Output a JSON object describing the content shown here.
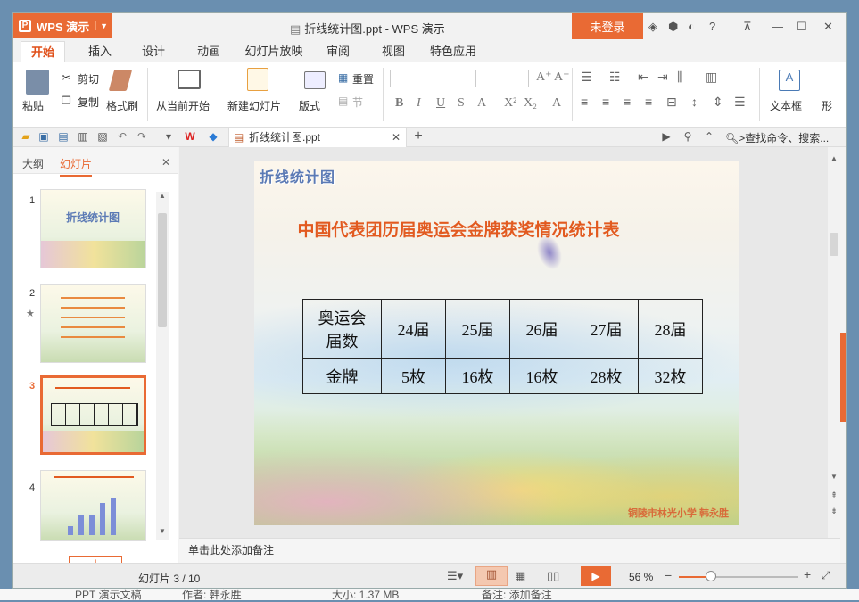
{
  "window": {
    "title": "折线统计图.ppt - WPS 演示",
    "app_button": "WPS 演示",
    "login": "未登录"
  },
  "tabs": [
    "开始",
    "插入",
    "设计",
    "动画",
    "幻灯片放映",
    "审阅",
    "视图",
    "特色应用"
  ],
  "ribbon": {
    "paste": "粘贴",
    "cut": "剪切",
    "copy": "复制",
    "format_painter": "格式刷",
    "from_current": "从当前开始",
    "new_slide": "新建幻灯片",
    "layout": "版式",
    "reset": "重置",
    "section": "节",
    "textbox": "文本框",
    "shape": "形"
  },
  "qat": {
    "doc_tab": "折线统计图.ppt",
    "search": ">查找命令、搜索..."
  },
  "left_panel": {
    "tab_outline": "大纲",
    "tab_slides": "幻灯片",
    "slide_numbers": [
      "1",
      "2",
      "3",
      "4"
    ]
  },
  "slide": {
    "title_badge": "折线统计图",
    "heading": "中国代表团历届奥运会金牌获奖情况统计表",
    "table": {
      "row1_label": "奥运会届数",
      "row2_label": "金牌",
      "sessions": [
        "24届",
        "25届",
        "26届",
        "27届",
        "28届"
      ],
      "medals": [
        "5枚",
        "16枚",
        "16枚",
        "28枚",
        "32枚"
      ]
    },
    "footer": "铜陵市林光小学 韩永胜"
  },
  "notes": "单击此处添加备注",
  "status": {
    "slide_info": "幻灯片 3 / 10",
    "zoom": "56 %"
  },
  "bottom": {
    "filetype": "PPT 演示文稿",
    "author": "作者: 韩永胜",
    "size": "大小: 1.37 MB",
    "note": "备注: 添加备注"
  },
  "colors": {
    "accent": "#e96a34",
    "heading": "#e25a20"
  }
}
